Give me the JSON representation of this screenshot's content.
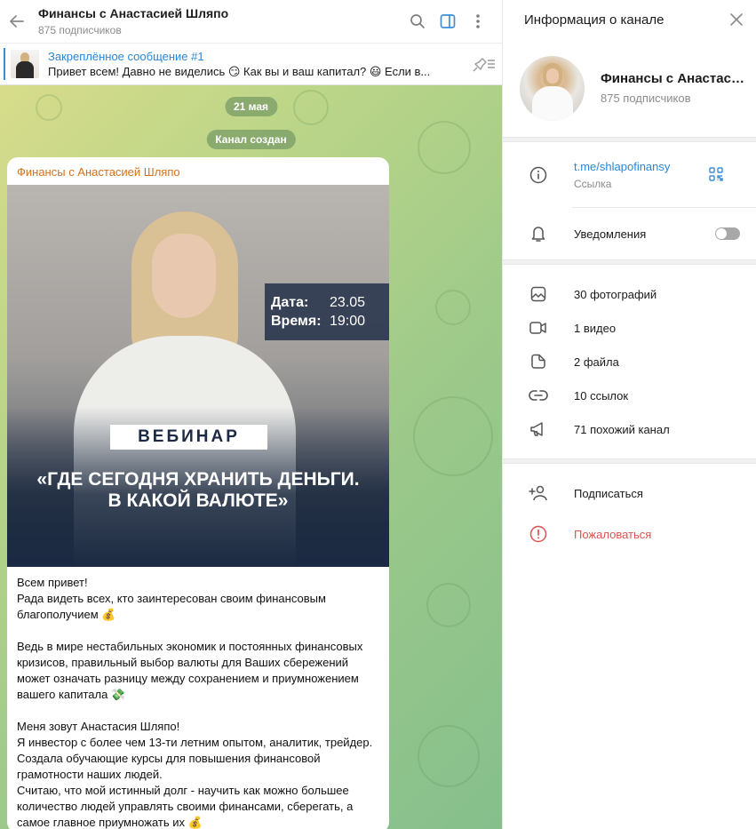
{
  "chat": {
    "title": "Финансы с Анастасией Шляпо",
    "subscribers": "875 подписчиков",
    "pinned_title": "Закреплённое сообщение #1",
    "pinned_text": "Привет всем! Давно не виделись 😏 Как вы и ваш капитал? 😃  Если в...",
    "date_pill": "21 мая",
    "service_pill": "Канал создан"
  },
  "post": {
    "author": "Финансы с Анастасией Шляпо",
    "image": {
      "date_label": "Дата:",
      "date_value": "23.05",
      "time_label": "Время:",
      "time_value": "19:00",
      "badge": "ВЕБИНАР",
      "headline_1": "«ГДЕ  СЕГОДНЯ ХРАНИТЬ ДЕНЬГИ.",
      "headline_2": "В КАКОЙ ВАЛЮТЕ»"
    },
    "text": "Всем привет!\nРада видеть всех, кто заинтересован своим финансовым благополучием 💰\n\nВедь в мире нестабильных экономик и постоянных финансовых кризисов, правильный выбор валюты для Ваших сбережений может означать разницу между сохранением и приумножением вашего капитала 💸\n\nМеня зовут Анастасия Шляпо!\nЯ инвестор с более чем 13-ти летним опытом, аналитик, трейдер.\nСоздала обучающие курсы для повышения финансовой грамотности наших людей.\nСчитаю, что мой истинный долг - научить как можно большее количество людей управлять своими финансами, сберегать, а самое главное приумножать их 💰"
  },
  "panel": {
    "title": "Информация о канале",
    "name": "Финансы с Анастасией Шляпо",
    "subscribers": "875 подписчиков",
    "link": "t.me/shlapofinansy",
    "link_label": "Ссылка",
    "notifications": "Уведомления",
    "notifications_on": false,
    "media": {
      "photos": "30 фотографий",
      "videos": "1 видео",
      "files": "2 файла",
      "links": "10 ссылок",
      "similar": "71 похожий канал"
    },
    "subscribe": "Подписаться",
    "report": "Пожаловаться"
  },
  "colors": {
    "accent": "#2b86d6",
    "author": "#d2711c",
    "danger": "#d9534f"
  }
}
